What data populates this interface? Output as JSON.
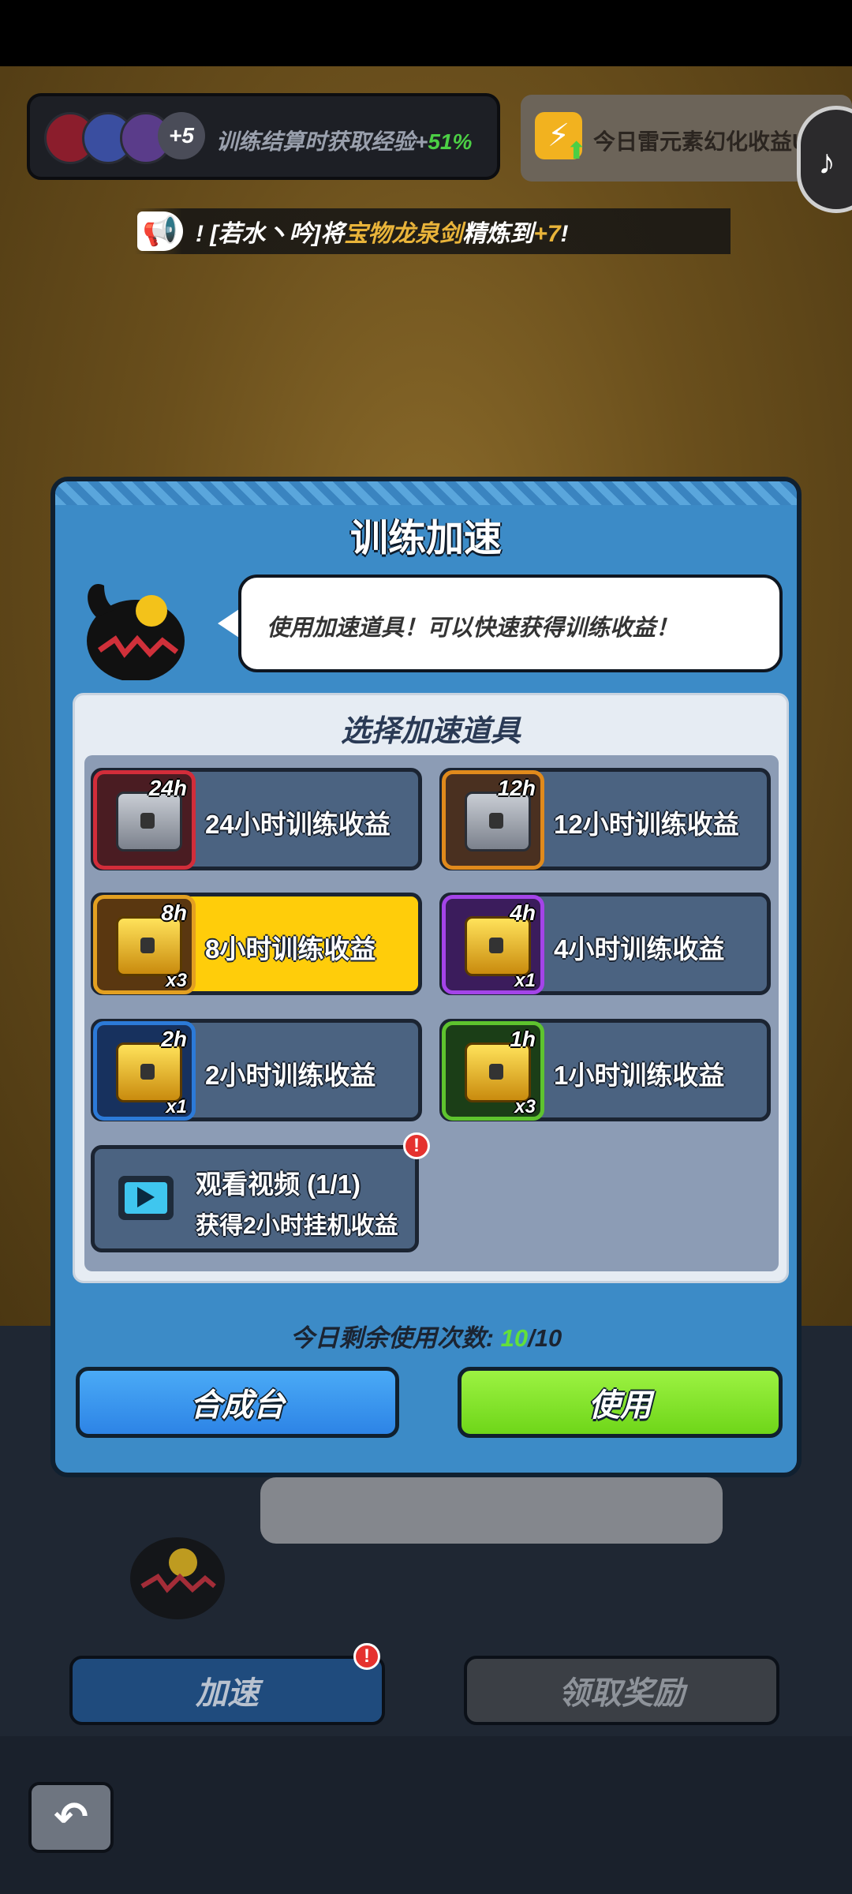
{
  "top_banner": {
    "avatar_extra": "+5",
    "exp_text": "训练结算时获取经验+",
    "exp_pct": "51%",
    "element_text": "今日雷元素幻化收益UP"
  },
  "notice": {
    "prefix": "! [若水丶吟]将",
    "item": "宝物龙泉剑",
    "middle": "精炼到",
    "level": "+7",
    "suffix": "!"
  },
  "modal": {
    "title": "训练加速",
    "bubble": "使用加速道具！可以快速获得训练收益！",
    "panel_title": "选择加速道具",
    "items": [
      {
        "duration": "24h",
        "label": "24小时训练收益",
        "qty": "",
        "chest": "silver-chest-icon",
        "frame": "red"
      },
      {
        "duration": "12h",
        "label": "12小时训练收益",
        "qty": "",
        "chest": "silver-chest-icon",
        "frame": "orange"
      },
      {
        "duration": "8h",
        "label": "8小时训练收益",
        "qty": "x3",
        "chest": "gold-chest-icon",
        "frame": "orange",
        "selected": true
      },
      {
        "duration": "4h",
        "label": "4小时训练收益",
        "qty": "x1",
        "chest": "gold-chest-icon",
        "frame": "purple"
      },
      {
        "duration": "2h",
        "label": "2小时训练收益",
        "qty": "x1",
        "chest": "gold-chest-icon",
        "frame": "blue"
      },
      {
        "duration": "1h",
        "label": "1小时训练收益",
        "qty": "x3",
        "chest": "gold-chest-icon",
        "frame": "green"
      }
    ],
    "video": {
      "title": "观看视频 (1/1)",
      "subtitle": "获得2小时挂机收益",
      "alert": "!"
    },
    "remaining_label": "今日剩余使用次数: ",
    "remaining_current": "10",
    "remaining_total": "/10",
    "buttons": {
      "craft": "合成台",
      "use": "使用"
    }
  },
  "underlay": {
    "accelerate": "加速",
    "claim": "领取奖励",
    "alert": "!"
  },
  "colors": {
    "modal_bg": "#3c8bc7",
    "selected_item": "#ffcd0a",
    "use_button": "#8fe83a",
    "craft_button": "#3b9af0",
    "highlight_green": "#63e03a",
    "gold_text": "#e9b43a"
  }
}
